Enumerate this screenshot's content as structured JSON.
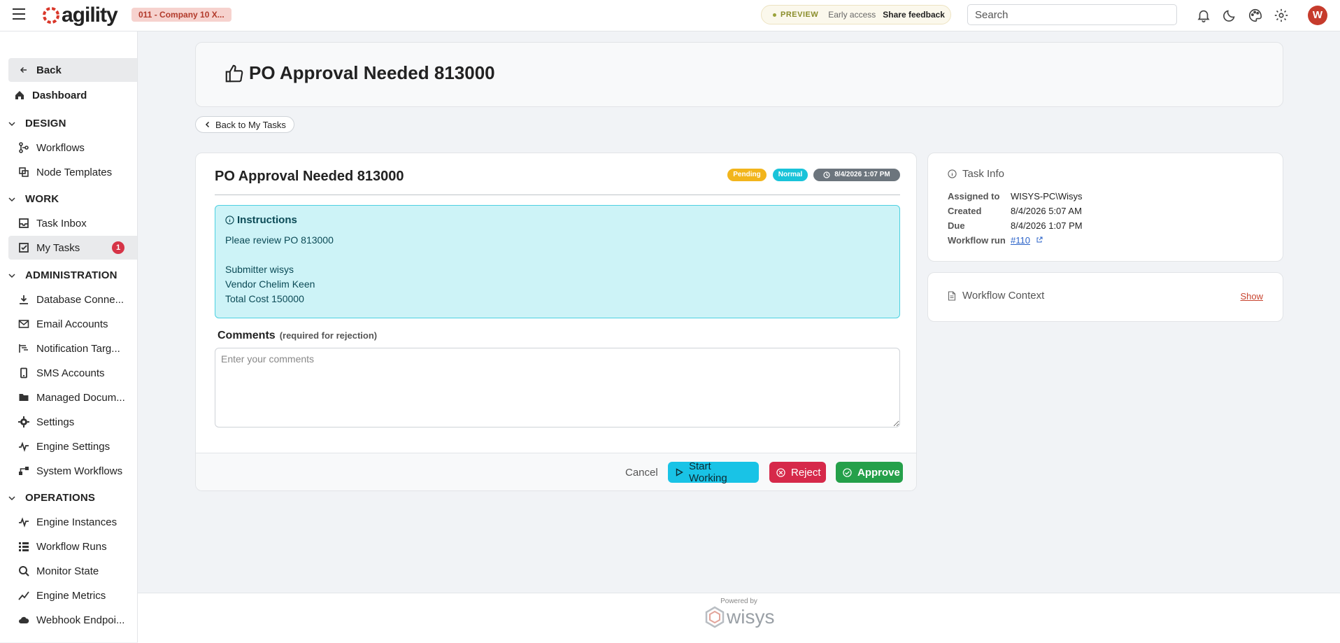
{
  "topbar": {
    "logo_text": "agility",
    "company": "011 - Company 10 X...",
    "preview_tag": "PREVIEW",
    "early_access": "Early access",
    "share_feedback": "Share feedback",
    "search_placeholder": "Search",
    "avatar_initial": "W"
  },
  "sidebar": {
    "back": "Back",
    "dashboard": "Dashboard",
    "sections": {
      "design": "DESIGN",
      "work": "WORK",
      "administration": "ADMINISTRATION",
      "operations": "OPERATIONS"
    },
    "items": {
      "workflows": "Workflows",
      "node_templates": "Node Templates",
      "task_inbox": "Task Inbox",
      "my_tasks": "My Tasks",
      "my_tasks_count": "1",
      "database_connections": "Database Conne...",
      "email_accounts": "Email Accounts",
      "notification_targets": "Notification Targ...",
      "sms_accounts": "SMS Accounts",
      "managed_documents": "Managed Docum...",
      "settings": "Settings",
      "engine_settings": "Engine Settings",
      "system_workflows": "System Workflows",
      "engine_instances": "Engine Instances",
      "workflow_runs": "Workflow Runs",
      "monitor_state": "Monitor State",
      "engine_metrics": "Engine Metrics",
      "webhook_endpoints": "Webhook Endpoi..."
    }
  },
  "page": {
    "title": "PO Approval Needed 813000",
    "back_to_tasks": "Back to My Tasks"
  },
  "task": {
    "title": "PO Approval Needed 813000",
    "status": "Pending",
    "priority": "Normal",
    "due_badge": "8/4/2026 1:07 PM",
    "instructions_title": "Instructions",
    "instructions_body": "Pleae review PO   813000\n\nSubmitter wisys\nVendor Chelim Keen\nTotal Cost 150000",
    "comments_label": "Comments",
    "comments_required": "(required for rejection)",
    "comments_placeholder": "Enter your comments",
    "comments_value": "",
    "buttons": {
      "cancel": "Cancel",
      "start_working": "Start Working",
      "reject": "Reject",
      "approve": "Approve"
    }
  },
  "task_info": {
    "title": "Task Info",
    "assigned_to_label": "Assigned to",
    "assigned_to": "WISYS-PC\\Wisys",
    "created_label": "Created",
    "created": "8/4/2026 5:07 AM",
    "due_label": "Due",
    "due": "8/4/2026 1:07 PM",
    "workflow_run_label": "Workflow run",
    "workflow_run": "#110"
  },
  "workflow_context": {
    "title": "Workflow Context",
    "show": "Show"
  },
  "footer": {
    "powered_by": "Powered by",
    "brand": "wisys"
  },
  "colors": {
    "pending": "#f2b51c",
    "normal": "#19c3d9",
    "reject": "#d6294a",
    "approve": "#25a04a",
    "start": "#19c3e6",
    "instructions_bg": "#cdf3f7",
    "brand_red": "#c63b2c"
  }
}
